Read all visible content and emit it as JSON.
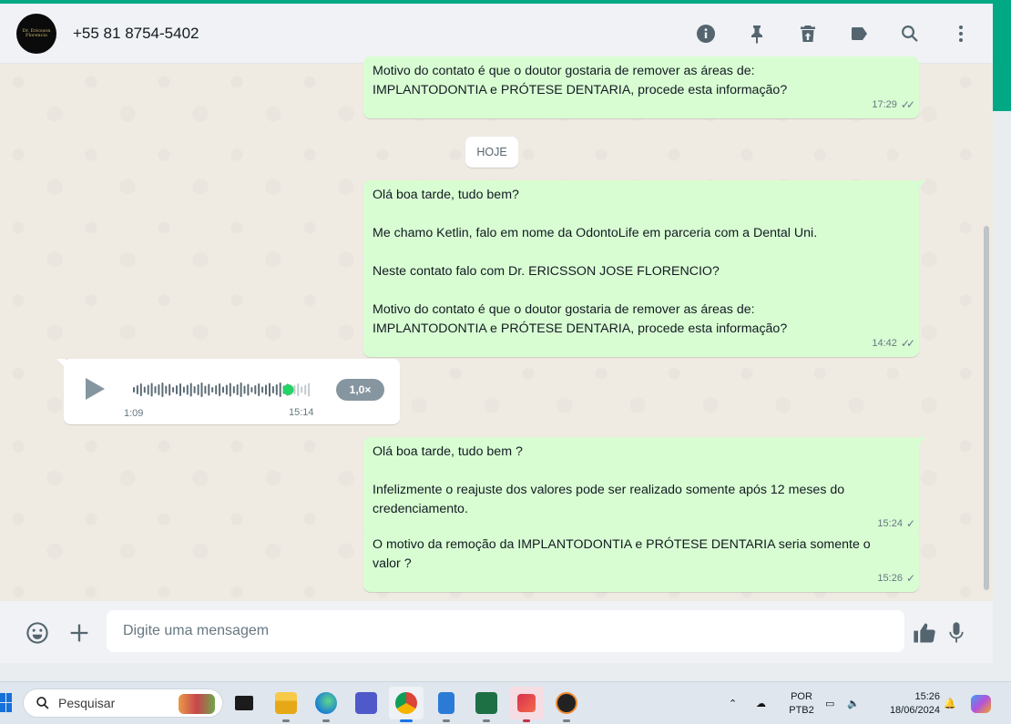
{
  "colors": {
    "accent": "#00a884",
    "outgoing_bubble": "#d9fdd3",
    "incoming_bubble": "#ffffff",
    "chat_background": "#efeae2",
    "voice_progress": "#25d366"
  },
  "header": {
    "contact_name": "+55 81 8754-5402",
    "avatar_text": "Dr. Ericsson Florencio",
    "icons": [
      "info-icon",
      "pin-icon",
      "delete-icon",
      "label-icon",
      "search-icon",
      "menu-icon"
    ]
  },
  "messages": {
    "m1": {
      "lines": [
        "Motivo do contato é que o doutor gostaria de remover as áreas de:",
        "IMPLANTODONTIA e PRÓTESE DENTARIA, procede esta informação?"
      ],
      "time": "17:29",
      "status": "read"
    },
    "date_separator": "HOJE",
    "m2": {
      "lines": [
        "Olá boa tarde, tudo bem?",
        "",
        "Me chamo Ketlin, falo em nome da OdontoLife em parceria com a Dental Uni.",
        "",
        "Neste contato falo com Dr. ERICSSON JOSE FLORENCIO?",
        "",
        "Motivo do contato é que o doutor gostaria de remover as áreas de:",
        "IMPLANTODONTIA e PRÓTESE DENTARIA, procede esta informação?"
      ],
      "time": "14:42",
      "status": "read"
    },
    "voice": {
      "duration": "1:09",
      "time": "15:14",
      "speed": "1,0×",
      "progress": 0.87
    },
    "m3": {
      "lines": [
        "Olá boa tarde, tudo bem ?",
        "",
        "Infelizmente o reajuste dos valores pode ser realizado somente após 12 meses do",
        "credenciamento."
      ],
      "time": "15:24",
      "status": "sent"
    },
    "m4": {
      "lines": [
        "O motivo da remoção da IMPLANTODONTIA e PRÓTESE DENTARIA seria somente o",
        "valor ?"
      ],
      "time": "15:26",
      "status": "sent"
    }
  },
  "composer": {
    "placeholder": "Digite uma mensagem",
    "icons": [
      "emoji-icon",
      "attach-plus-icon",
      "thumbs-up-icon",
      "microphone-icon"
    ]
  },
  "taskbar": {
    "search_label": "Pesquisar",
    "apps": [
      "task-view",
      "file-explorer",
      "edge",
      "teams",
      "chrome",
      "notepad",
      "excel",
      "snipping-tool",
      "media-player"
    ],
    "language_top": "POR",
    "language_bottom": "PTB2",
    "time": "15:26",
    "date": "18/06/2024"
  }
}
